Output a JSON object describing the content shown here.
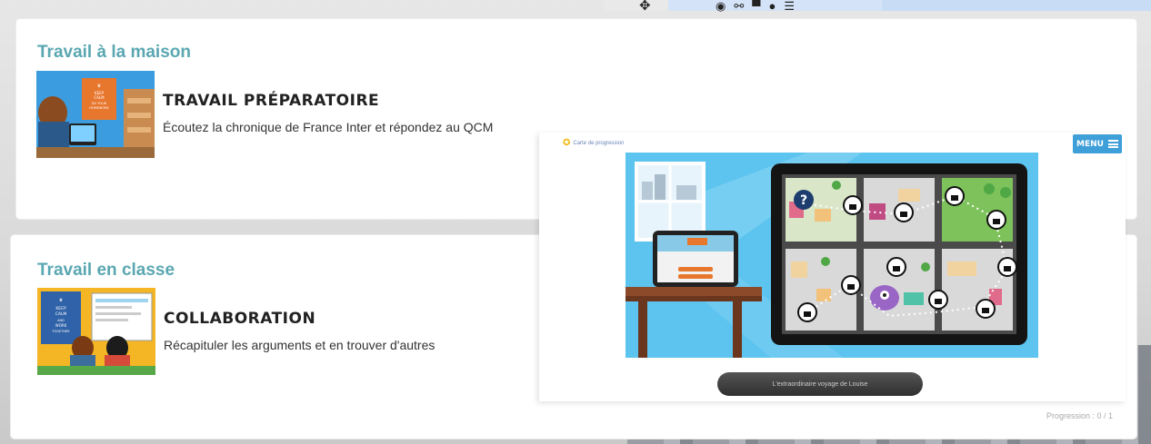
{
  "colors": {
    "section_title": "#5aa7b2",
    "menu_button": "#3f9fd8",
    "illustration_sky": "#5cc4ef"
  },
  "toolbar": {
    "icons": [
      "move-icon",
      "eye-icon",
      "share-icon",
      "hat-icon",
      "person-icon",
      "list-icon"
    ]
  },
  "home": {
    "title": "Travail à la maison",
    "activity": {
      "title": "TRAVAIL PRÉPARATOIRE",
      "description": "Écoutez la chronique de France Inter et répondez au QCM",
      "poster_text": "KEEP CALM AND DO YOUR HOMEWORK"
    }
  },
  "classwork": {
    "title": "Travail en classe",
    "activity": {
      "title": "COLLABORATION",
      "description": "Récapituler les arguments et en trouver d'autres",
      "poster_text": "KEEP CALM AND WORK TOGETHER"
    }
  },
  "overlay": {
    "carte_label": "Carte de progression",
    "menu_label": "MENU",
    "play_label": "L'extraordinaire voyage de Louise"
  },
  "progress": "Progression : 0 / 1"
}
